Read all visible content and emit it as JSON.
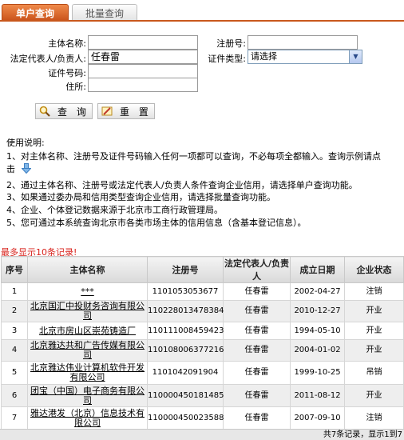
{
  "tabs": {
    "active": "单户查询",
    "inactive": "批量查询"
  },
  "form": {
    "entity_name_label": "主体名称:",
    "entity_name_value": "",
    "reg_no_label": "注册号:",
    "reg_no_value": "",
    "legal_rep_label": "法定代表人/负责人:",
    "legal_rep_value": "任春雷",
    "cert_type_label": "证件类型:",
    "cert_type_selected": "请选择",
    "cert_no_label": "证件号码:",
    "cert_no_value": "",
    "address_label": "住所:",
    "address_value": "",
    "query_button": "查 询",
    "reset_button": "重 置"
  },
  "help": {
    "title": "使用说明:",
    "line1a": "1、对主体名称、注册号及证件号码输入任何一项都可以查询，不必每项全都输入。查询示例请点",
    "line1b": "击",
    "line2": "2、通过主体名称、注册号或法定代表人/负责人条件查询企业信用，请选择单户查询功能。",
    "line3": "3、如果通过委办局和信用类型查询企业信用，请选择批量查询功能。",
    "line4": "4、企业、个体登记数据来源于北京市工商行政管理局。",
    "line5": "5、您可通过本系统查询北京市各类市场主体的信用信息（含基本登记信息）。"
  },
  "notice": "最多显示10条记录!",
  "table": {
    "headers": [
      "序号",
      "主体名称",
      "注册号",
      "法定代表人/负责人",
      "成立日期",
      "企业状态"
    ],
    "rows": [
      {
        "no": "1",
        "name1": "***",
        "name2": "",
        "reg": "1101053053677",
        "rep": "任春雷",
        "date": "2002-04-27",
        "status": "注销"
      },
      {
        "no": "2",
        "name1": "北京国汇中投财务咨询有限公",
        "name2": "司",
        "reg": "110228013478384",
        "rep": "任春雷",
        "date": "2010-12-27",
        "status": "开业"
      },
      {
        "no": "3",
        "name1": "北京市房山区崇苑铸造厂",
        "name2": "",
        "reg": "110111008459423",
        "rep": "任春雷",
        "date": "1994-05-10",
        "status": "开业"
      },
      {
        "no": "4",
        "name1": "北京雅达共和广告传媒有限公",
        "name2": "司",
        "reg": "110108006377216",
        "rep": "任春雷",
        "date": "2004-01-02",
        "status": "开业"
      },
      {
        "no": "5",
        "name1": "北京雅达伟业计算机软件开发",
        "name2": "有限公司",
        "reg": "1101042091904",
        "rep": "任春雷",
        "date": "1999-10-25",
        "status": "吊销"
      },
      {
        "no": "6",
        "name1": "团宝（中国）电子商务有限公",
        "name2": "司",
        "reg": "110000450181485",
        "rep": "任春雷",
        "date": "2011-08-12",
        "status": "开业"
      },
      {
        "no": "7",
        "name1": "雅达港发（北京）信息技术有",
        "name2": "限公司",
        "reg": "110000450023588",
        "rep": "任春雷",
        "date": "2007-09-10",
        "status": "注销"
      }
    ]
  },
  "footer": "共7条记录，显示1到7",
  "colors": {
    "tab_active": "#d66a2a",
    "notice": "#d8201a",
    "row_even": "#eeeeee"
  },
  "icons": {
    "query": "magnifier-icon",
    "reset": "eraser-icon",
    "help": "down-arrow-icon"
  }
}
